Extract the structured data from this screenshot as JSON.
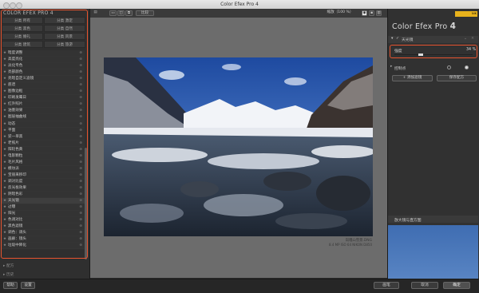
{
  "window": {
    "title": "Color Efex Pro 4"
  },
  "left": {
    "brand": "COLOR EFEX PRO 4",
    "categories": [
      "分类 所有",
      "分类 激定",
      "分类 黑色",
      "分类 自然",
      "分类 婚礼",
      "分类 风景",
      "分类 建筑",
      "分类 旅游"
    ],
    "filters": [
      "暗度调整",
      "高度亮化",
      "淡化专色",
      "亮部颜色",
      "亮暗自定义滤镜",
      "底谱",
      "图像边框",
      "印刷发霉日",
      "红外照片",
      "油墨效果",
      "图层抽曲线",
      "动态",
      "平面",
      "逆一单黑",
      "老照片",
      "阳轮色黄",
      "电影颗粒",
      "毛片风格",
      "模坊派",
      "宝丽来移印",
      "调对比度",
      "反光板效果",
      "阴暗色彩",
      "天光镜",
      "过曝",
      "阳光",
      "色调对比",
      "黑色滤镜",
      "调色：调头",
      "画廊：镜头",
      "垃圾中降化"
    ],
    "selected_filter": "天光镜",
    "presets_label": "配方",
    "history_label": "历史"
  },
  "toolbar": {
    "compare_label": "比较",
    "zoom_label": "缩放（100 %）"
  },
  "image": {
    "filename": "岗嘎山雪景.DNG",
    "info": "8.4 MP  ISO 64  NIKON D850"
  },
  "right": {
    "app_name": "Color Efex Pro",
    "app_version": "4",
    "logo_tag": "NIK",
    "filter_name": "天光镜",
    "strength_label": "强度",
    "strength_value": "34 %",
    "strength_level": 0.34,
    "control_points_label": "控制点",
    "add_filter_label": "添加滤镜",
    "save_preset_label": "保存配方",
    "loupe_label": "放大镜与直方图"
  },
  "bottom": {
    "help": "帮助",
    "settings": "设置",
    "brush": "画笔",
    "cancel": "取消",
    "ok": "确定"
  },
  "colors": {
    "accent": "#e8542f",
    "panel": "#2f2f2f",
    "canvas": "#6c6c6c"
  }
}
